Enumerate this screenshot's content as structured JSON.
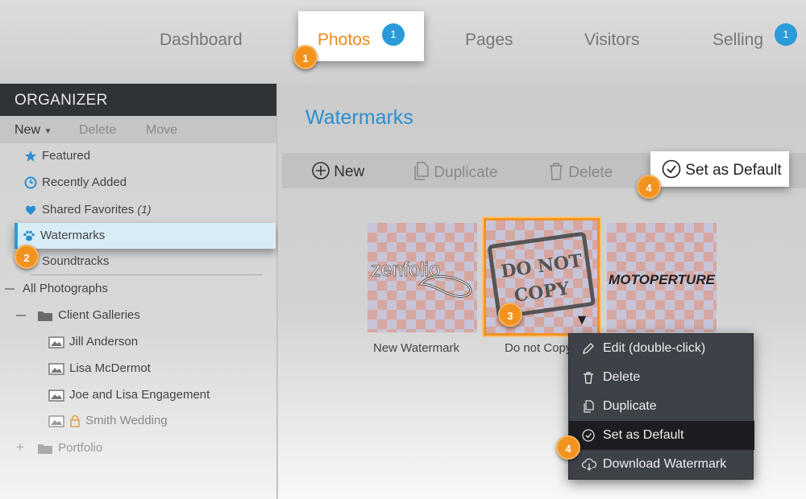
{
  "topnav": {
    "tabs": [
      {
        "label": "Dashboard"
      },
      {
        "label": "Photos",
        "badge": "1",
        "active": true
      },
      {
        "label": "Pages"
      },
      {
        "label": "Visitors"
      },
      {
        "label": "Selling",
        "badge": "1"
      }
    ]
  },
  "steps": {
    "one": "1",
    "two": "2",
    "three": "3",
    "four": "4"
  },
  "sidebar": {
    "header": "ORGANIZER",
    "toolbar": {
      "new": "New",
      "delete": "Delete",
      "move": "Move"
    },
    "items": [
      {
        "label": "Featured",
        "icon": "star-icon"
      },
      {
        "label": "Recently Added",
        "icon": "clock-icon"
      },
      {
        "label": "Shared Favorites",
        "count": "(1)",
        "icon": "heart-icon"
      },
      {
        "label": "Watermarks",
        "icon": "paw-icon",
        "selected": true
      },
      {
        "label": "Soundtracks",
        "icon": "music-icon"
      }
    ],
    "tree": {
      "root": "All Photographs",
      "group": "Client Galleries",
      "galleries": [
        "Jill Anderson",
        "Lisa McDermot",
        "Joe and Lisa Engagement",
        "Smith Wedding"
      ],
      "portfolio": "Portfolio"
    }
  },
  "main": {
    "title": "Watermarks",
    "toolbar": {
      "new": "New",
      "duplicate": "Duplicate",
      "delete": "Delete",
      "set_default": "Set as Default"
    },
    "thumbnails": [
      {
        "label": "New Watermark",
        "art": "zenfolio"
      },
      {
        "label": "Do not Copy",
        "art_line1": "DO NOT",
        "art_line2": "COPY"
      },
      {
        "label": "",
        "art": "MOTOPERTURE"
      }
    ]
  },
  "context_menu": {
    "items": [
      {
        "label": "Edit (double-click)",
        "icon": "pencil-icon"
      },
      {
        "label": "Delete",
        "icon": "trash-icon"
      },
      {
        "label": "Duplicate",
        "icon": "duplicate-icon"
      },
      {
        "label": "Set as Default",
        "icon": "check-circle-icon",
        "active": true
      },
      {
        "label": "Download Watermark",
        "icon": "cloud-download-icon"
      }
    ]
  },
  "colors": {
    "accent": "#2a9bd8",
    "orange": "#f2931f",
    "menu_bg": "#3d4248"
  }
}
